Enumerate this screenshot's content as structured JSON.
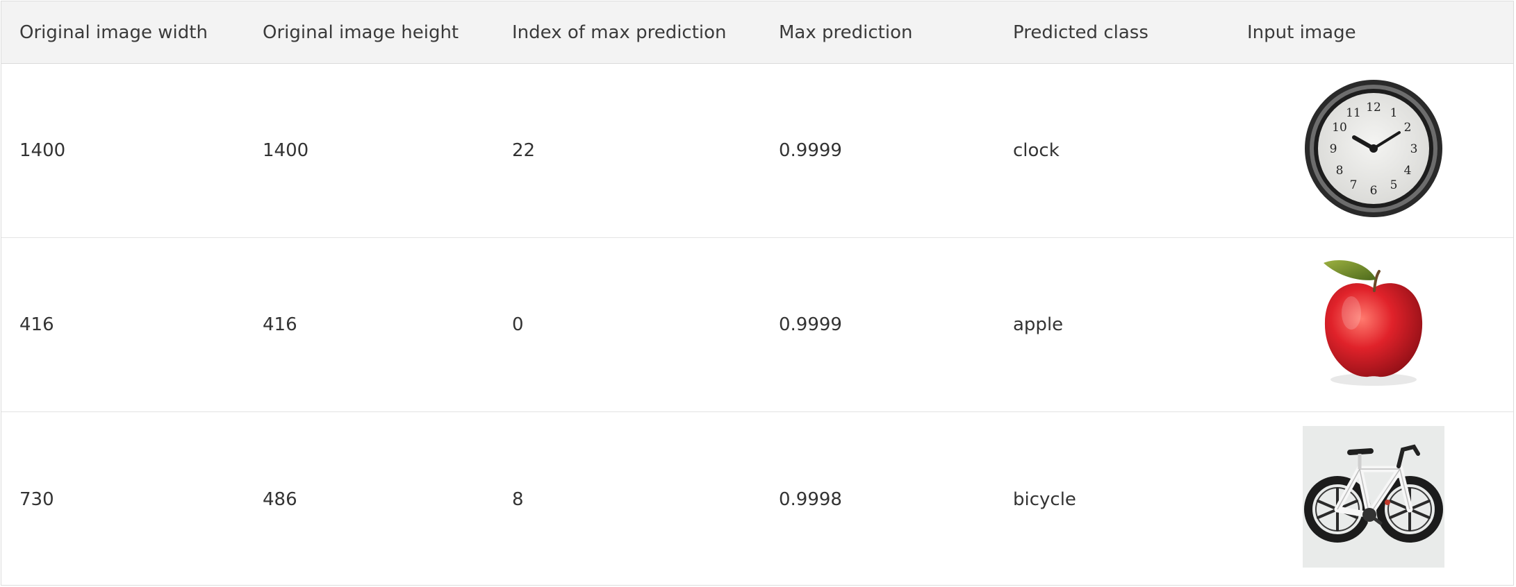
{
  "table": {
    "headers": [
      "Original image width",
      "Original image height",
      "Index of max prediction",
      "Max prediction",
      "Predicted class",
      "Input image"
    ],
    "rows": [
      {
        "width": "1400",
        "height": "1400",
        "index": "22",
        "max_prediction": "0.9999",
        "predicted_class": "clock",
        "image": "clock-image"
      },
      {
        "width": "416",
        "height": "416",
        "index": "0",
        "max_prediction": "0.9999",
        "predicted_class": "apple",
        "image": "apple-image"
      },
      {
        "width": "730",
        "height": "486",
        "index": "8",
        "max_prediction": "0.9998",
        "predicted_class": "bicycle",
        "image": "bicycle-image"
      }
    ]
  },
  "colors": {
    "header_background": "#f3f3f3",
    "border": "#dcdcdc",
    "text": "#333333"
  }
}
